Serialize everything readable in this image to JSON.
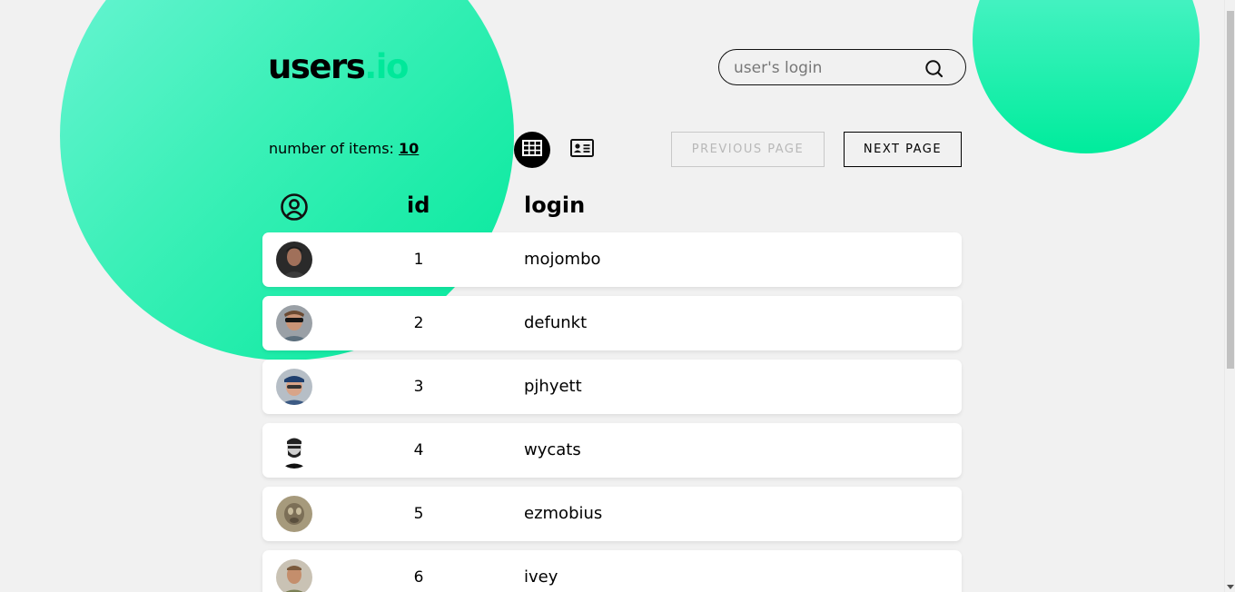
{
  "logo": {
    "main": "users",
    "accent": ".io"
  },
  "colors": {
    "accent": "#00e89a",
    "background": "#f1f1f1"
  },
  "search": {
    "placeholder": "user's login",
    "value": "",
    "icon": "search-icon"
  },
  "toolbar": {
    "items_label": "number of items:",
    "items_count": "10",
    "view_table_icon": "table-grid-icon",
    "view_cards_icon": "id-card-icon",
    "prev_label": "PREVIOUS PAGE",
    "next_label": "NEXT PAGE"
  },
  "table": {
    "headers": {
      "avatar_icon": "user-circle-icon",
      "id": "id",
      "login": "login"
    },
    "rows": [
      {
        "id": "1",
        "login": "mojombo"
      },
      {
        "id": "2",
        "login": "defunkt"
      },
      {
        "id": "3",
        "login": "pjhyett"
      },
      {
        "id": "4",
        "login": "wycats"
      },
      {
        "id": "5",
        "login": "ezmobius"
      },
      {
        "id": "6",
        "login": "ivey"
      }
    ]
  }
}
